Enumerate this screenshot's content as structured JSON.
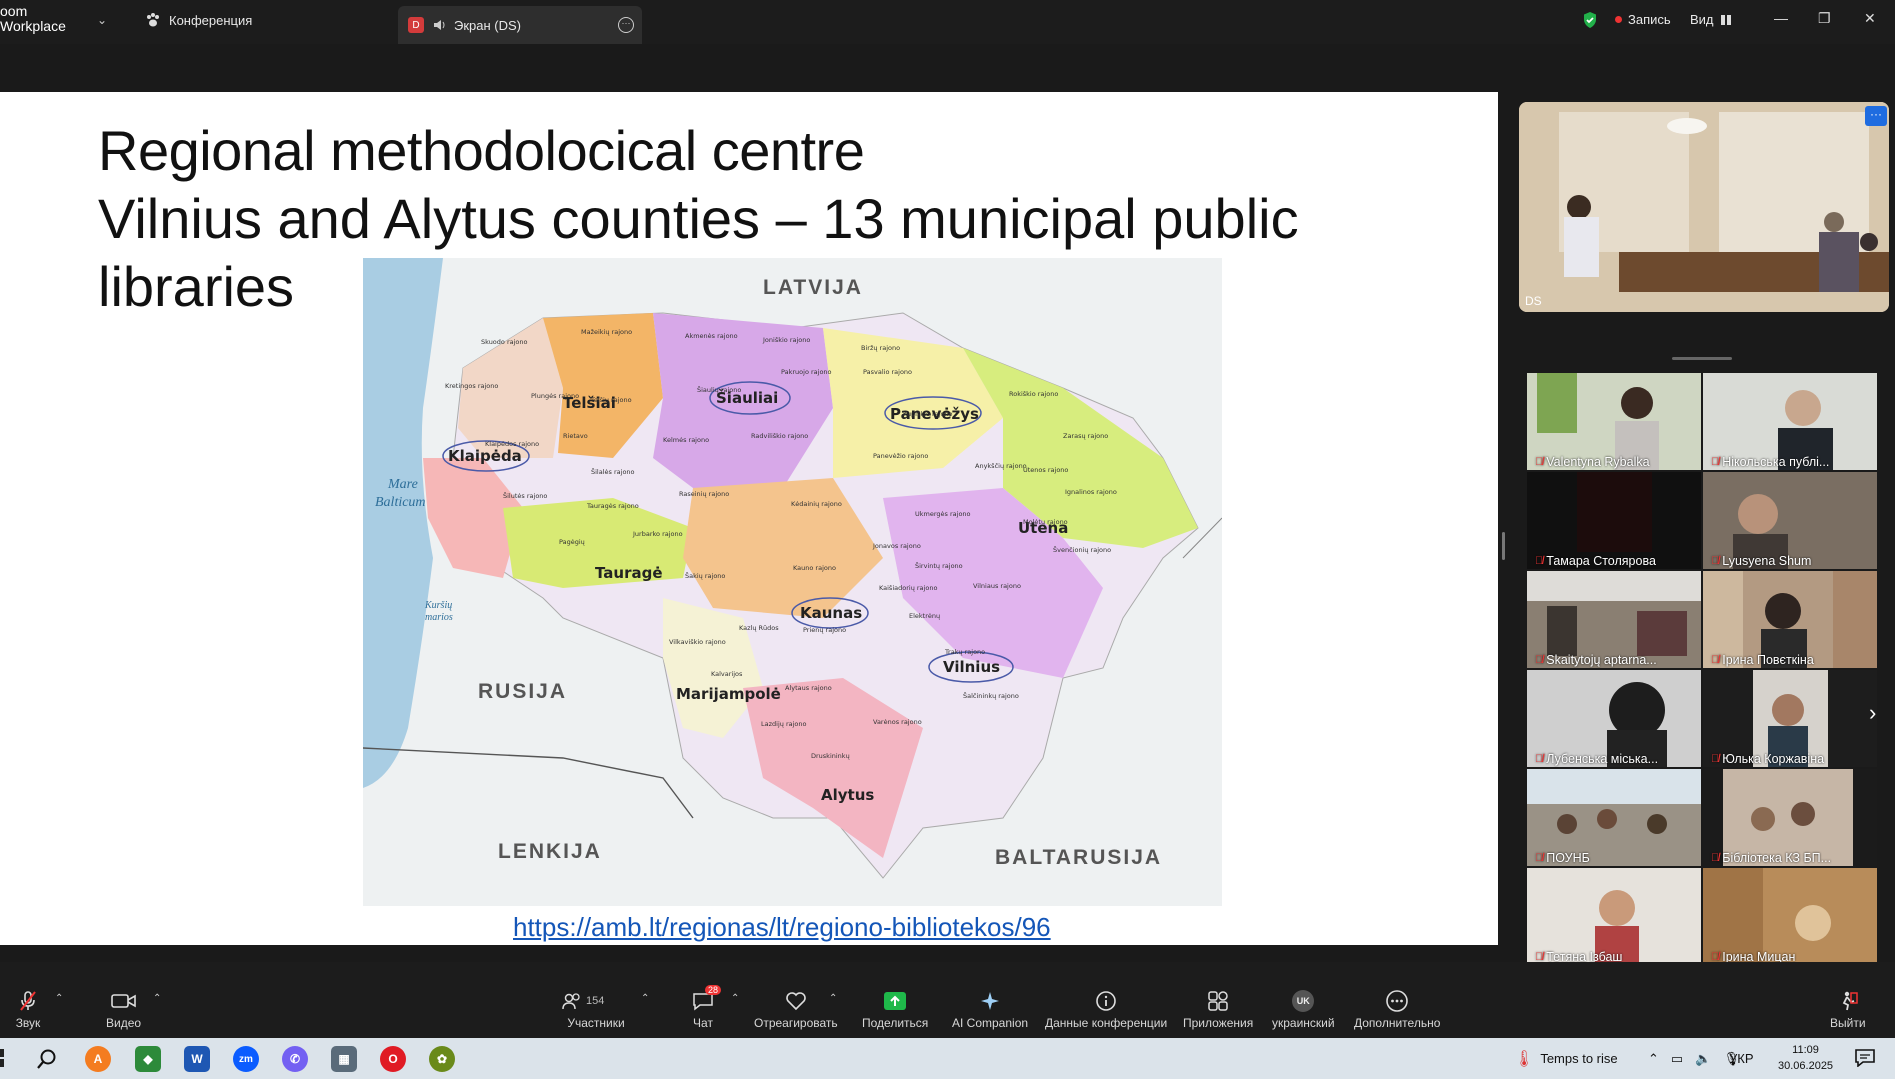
{
  "app": {
    "logo_line1": "oom",
    "logo_line2": "Workplace"
  },
  "tabs": {
    "conference": "Конференция",
    "screen_badge": "D",
    "screen": "Экран (DS)"
  },
  "top_right": {
    "record": "Запись",
    "view": "Вид"
  },
  "slide": {
    "title": "Regional methodolocical centre",
    "subtitle": "Vilnius and Alytus counties – 13 municipal public libraries",
    "link": "https://amb.lt/regionas/lt/regiono-bibliotekos/96"
  },
  "map": {
    "countries": {
      "north": "LATVIJA",
      "west_sea1": "Mare",
      "west_sea2": "Balticum",
      "lagoon1": "Kuršių",
      "lagoon2": "marios",
      "southwest": "RUSIJA",
      "south": "LENKIJA",
      "southeast": "BALTARUSIJA"
    },
    "regions": [
      "Telšiai",
      "Šiauliai",
      "Panevėžys",
      "Klaipėda",
      "Utena",
      "Tauragė",
      "Kaunas",
      "Vilnius",
      "Marijampolė",
      "Alytus"
    ],
    "districts": [
      "Skuodo rajono",
      "Mažeikių rajono",
      "Akmenės rajono",
      "Joniškio rajono",
      "Biržų rajono",
      "Kretingos rajono",
      "Plungės rajono",
      "Telšių rajono",
      "Pakruojo rajono",
      "Pasvalio rajono",
      "Rokiškio rajono",
      "Šiaulių rajono",
      "Kupiškio rajono",
      "Rietavo",
      "Kelmės rajono",
      "Radviliškio rajono",
      "Zarasų rajono",
      "Klaipėdos rajono",
      "Šilalės rajono",
      "Panevėžio rajono",
      "Anykščių rajono",
      "Utenos rajono",
      "Šilutės rajono",
      "Raseinių rajono",
      "Kėdainių rajono",
      "Ignalinos rajono",
      "Tauragės rajono",
      "Jurbarko rajono",
      "Ukmergės rajono",
      "Molėtų rajono",
      "Pagėgių",
      "Jonavos rajono",
      "Švenčionių rajono",
      "Kauno rajono",
      "Širvintų rajono",
      "Šakių rajono",
      "Kaišiadorių rajono",
      "Vilniaus rajono",
      "Elektrėnų",
      "Kazlų Rūdos",
      "Prienų rajono",
      "Vilkaviškio rajono",
      "Trakų rajono",
      "Kalvarijos",
      "Alytaus rajono",
      "Šalčininkų rajono",
      "Lazdijų rajono",
      "Varėnos rajono",
      "Druskininkų"
    ]
  },
  "speaker": {
    "name": "DS"
  },
  "participants": [
    "Valentyna Rybalka",
    "Нікольська публі...",
    "Тамара Столярова",
    "Lyusyena Shum",
    "Skaitytojų aptarna...",
    "Ірина Повєткіна",
    "Лубенська міська...",
    "Юлька Коржавіна",
    "ПОУНБ",
    "Бібліотека КЗ БП...",
    "Тетяна Ізбаш",
    "Ірина Мицан"
  ],
  "toolbar": {
    "audio": "Звук",
    "video": "Видео",
    "participants_count": "154",
    "participants": "Участники",
    "chat_badge": "28",
    "chat": "Чат",
    "react": "Отреагировать",
    "share": "Поделиться",
    "ai": "AI Companion",
    "meeting_info": "Данные конференции",
    "apps": "Приложения",
    "lang_badge": "UK",
    "language": "украинский",
    "more": "Дополнительно",
    "leave": "Выйти"
  },
  "taskbar": {
    "weather": "Temps to rise",
    "lang": "УКР",
    "time": "11:09",
    "date": "30.06.2025"
  },
  "colors": {
    "accent": "#1f6ce0",
    "share_green": "#1fb84a",
    "link": "#1456b8",
    "alert_red": "#e33333"
  }
}
